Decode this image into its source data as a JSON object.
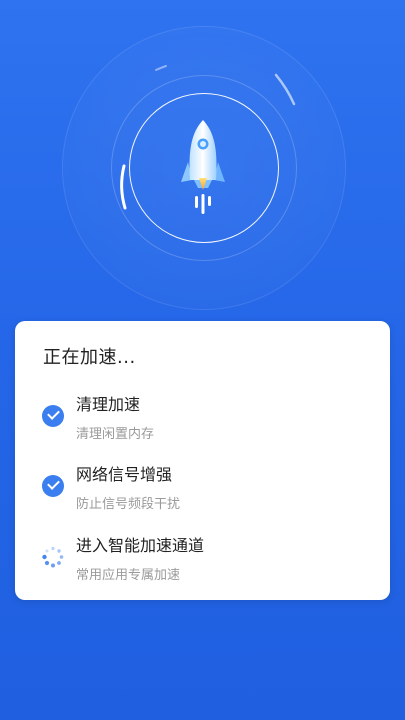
{
  "hero": {
    "icons": {
      "rocket": "rocket-icon"
    },
    "colors": {
      "background": "#2567e8",
      "accent": "#3a7ef0"
    }
  },
  "card": {
    "title": "正在加速...",
    "steps": [
      {
        "title": "清理加速",
        "subtitle": "清理闲置内存",
        "status": "done",
        "icon": "check-icon"
      },
      {
        "title": "网络信号增强",
        "subtitle": "防止信号频段干扰",
        "status": "done",
        "icon": "check-icon"
      },
      {
        "title": "进入智能加速通道",
        "subtitle": "常用应用专属加速",
        "status": "loading",
        "icon": "loading-spinner-icon"
      }
    ]
  }
}
